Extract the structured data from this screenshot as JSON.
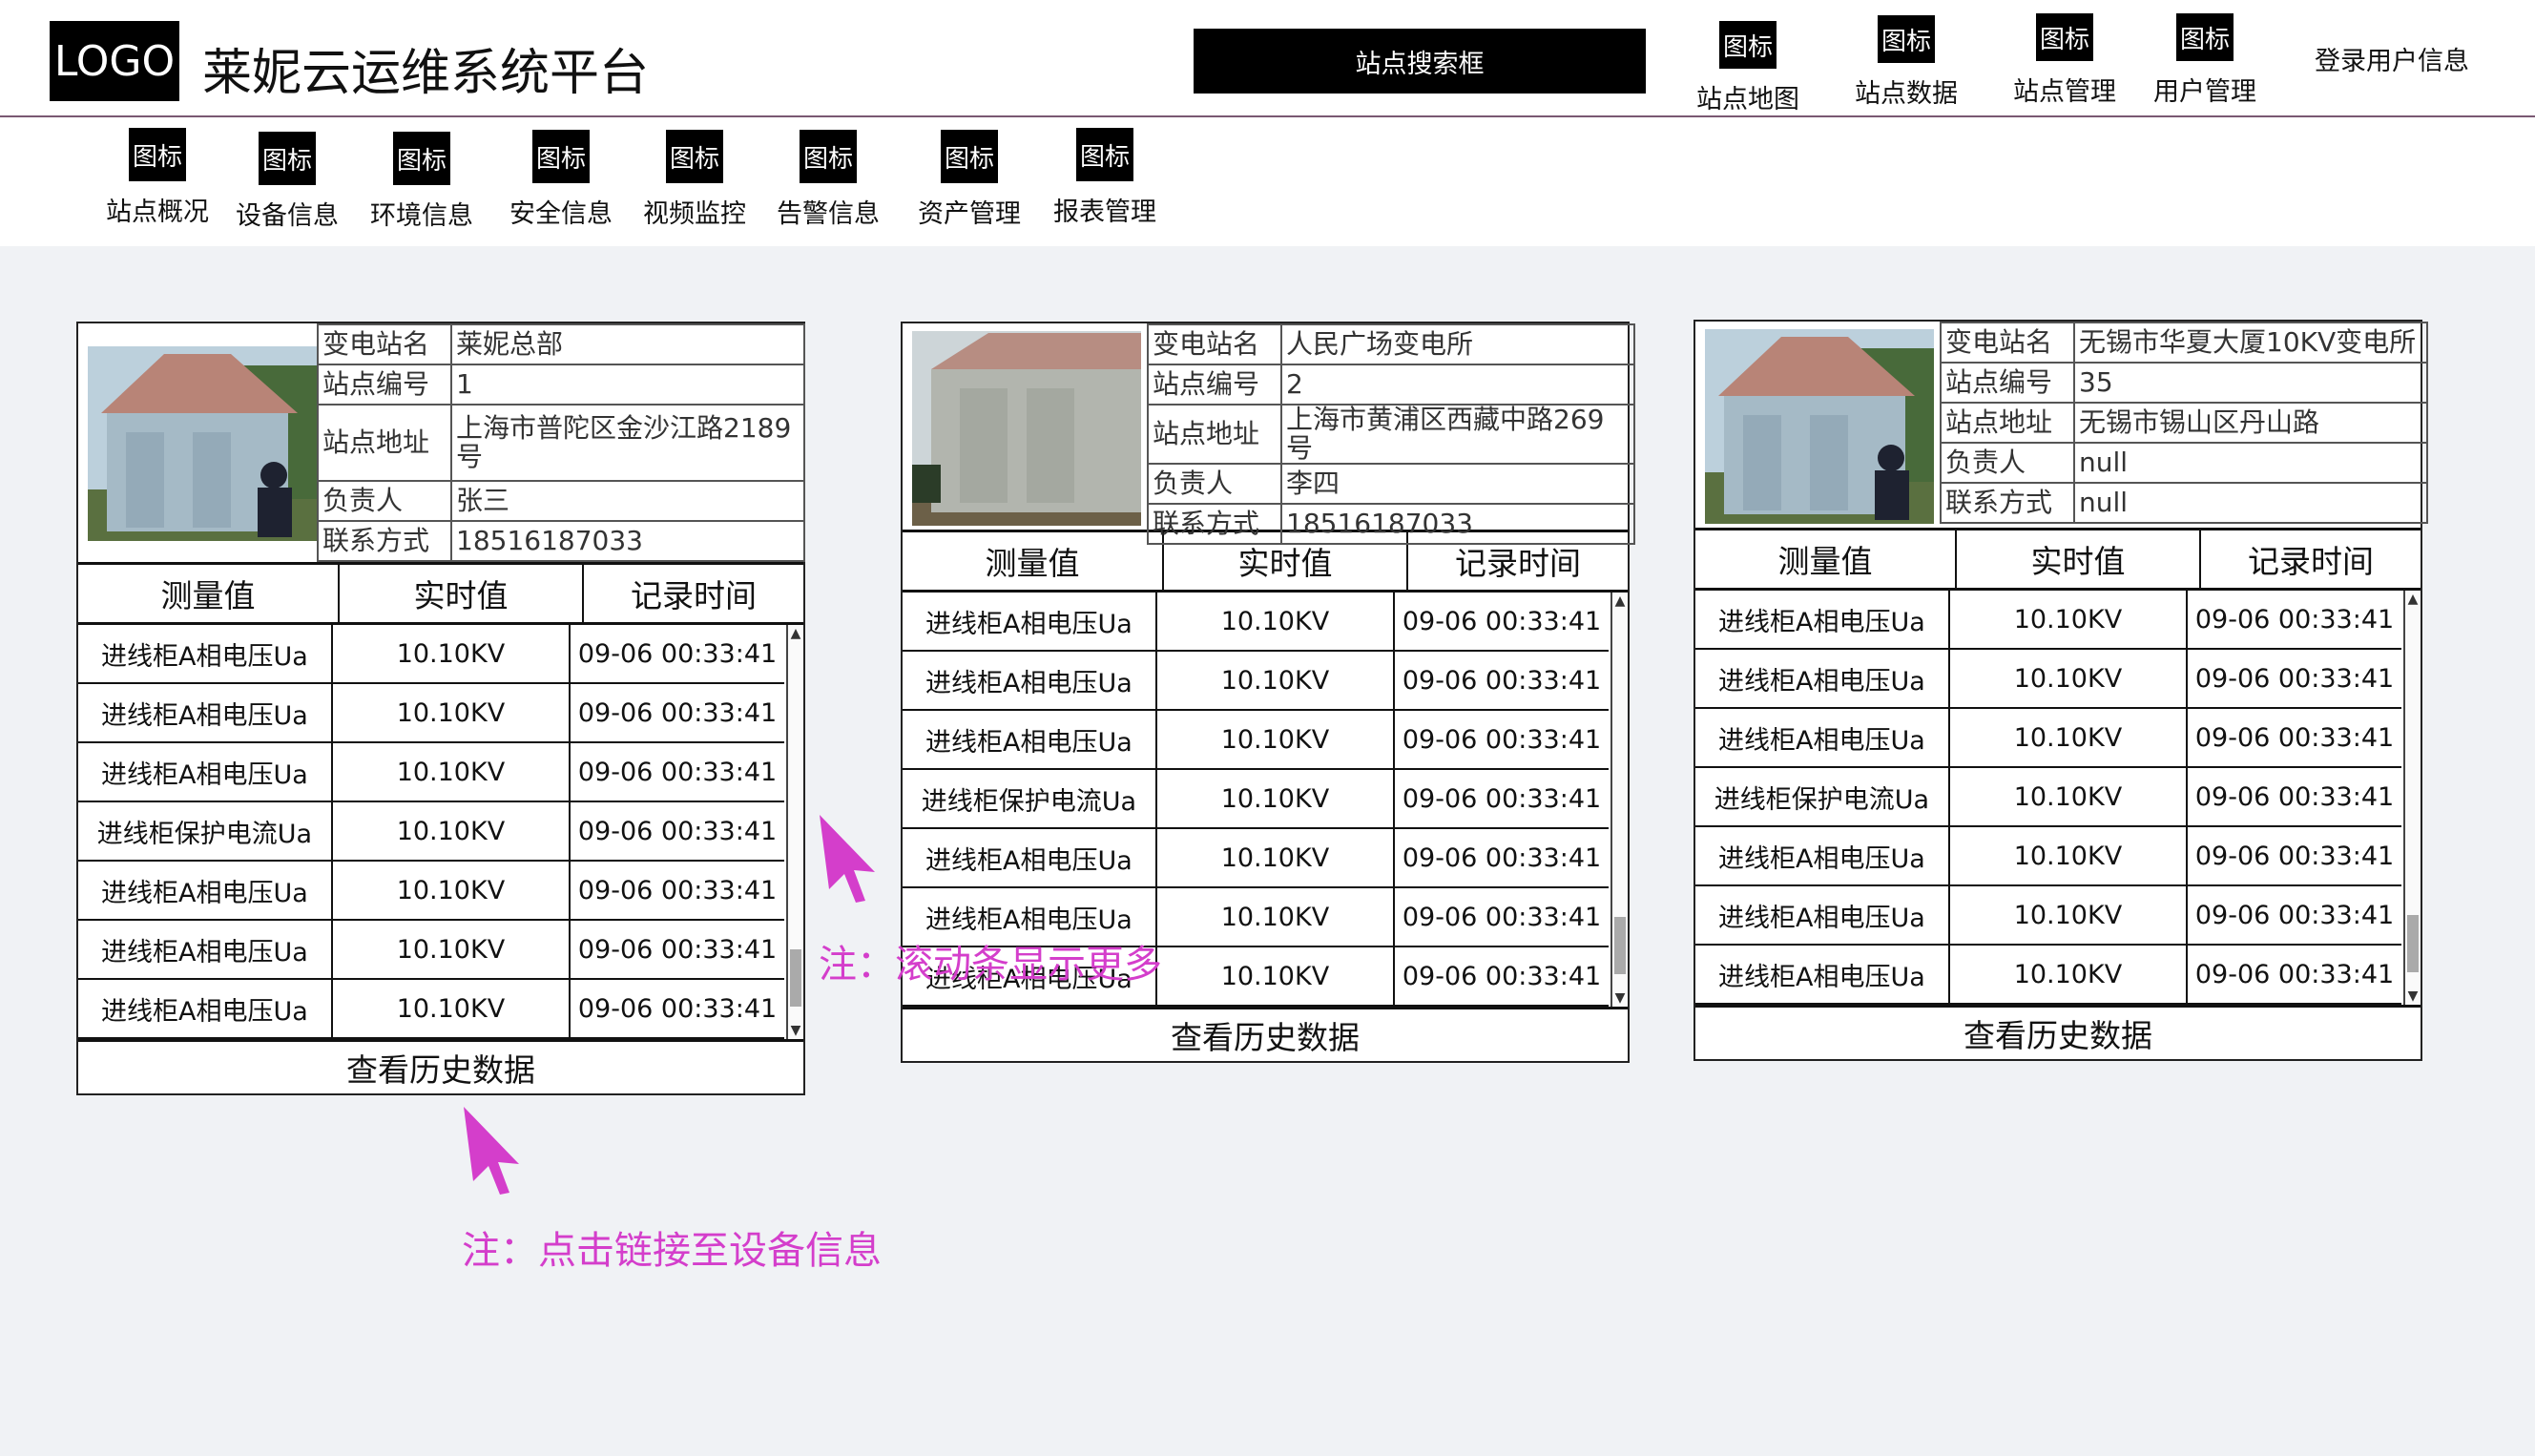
{
  "header": {
    "logo": "LOGO",
    "title": "莱妮云运维系统平台",
    "search_label": "站点搜索框",
    "user_info": "登录用户信息",
    "nav": [
      {
        "icon": "图标",
        "label": "站点地图"
      },
      {
        "icon": "图标",
        "label": "站点数据"
      },
      {
        "icon": "图标",
        "label": "站点管理"
      },
      {
        "icon": "图标",
        "label": "用户管理"
      }
    ]
  },
  "subnav": [
    {
      "icon": "图标",
      "label": "站点概况"
    },
    {
      "icon": "图标",
      "label": "设备信息"
    },
    {
      "icon": "图标",
      "label": "环境信息"
    },
    {
      "icon": "图标",
      "label": "安全信息"
    },
    {
      "icon": "图标",
      "label": "视频监控"
    },
    {
      "icon": "图标",
      "label": "告警信息"
    },
    {
      "icon": "图标",
      "label": "资产管理"
    },
    {
      "icon": "图标",
      "label": "报表管理"
    }
  ],
  "cards": [
    {
      "info": [
        {
          "key": "变电站名",
          "value": "莱妮总部"
        },
        {
          "key": "站点编号",
          "value": "1"
        },
        {
          "key": "站点地址",
          "value": "上海市普陀区金沙江路2189号"
        },
        {
          "key": "负责人",
          "value": "张三"
        },
        {
          "key": "联系方式",
          "value": "18516187033"
        }
      ],
      "columns": [
        "测量值",
        "实时值",
        "记录时间"
      ],
      "rows": [
        [
          "进线柜A相电压Ua",
          "10.10KV",
          "09-06 00:33:41"
        ],
        [
          "进线柜A相电压Ua",
          "10.10KV",
          "09-06 00:33:41"
        ],
        [
          "进线柜A相电压Ua",
          "10.10KV",
          "09-06 00:33:41"
        ],
        [
          "进线柜保护电流Ua",
          "10.10KV",
          "09-06 00:33:41"
        ],
        [
          "进线柜A相电压Ua",
          "10.10KV",
          "09-06 00:33:41"
        ],
        [
          "进线柜A相电压Ua",
          "10.10KV",
          "09-06 00:33:41"
        ],
        [
          "进线柜A相电压Ua",
          "10.10KV",
          "09-06 00:33:41"
        ]
      ],
      "history": "查看历史数据"
    },
    {
      "info": [
        {
          "key": "变电站名",
          "value": "人民广场变电所"
        },
        {
          "key": "站点编号",
          "value": "2"
        },
        {
          "key": "站点地址",
          "value": "上海市黄浦区西藏中路269号"
        },
        {
          "key": "负责人",
          "value": "李四"
        },
        {
          "key": "联系方式",
          "value": "18516187033"
        }
      ],
      "columns": [
        "测量值",
        "实时值",
        "记录时间"
      ],
      "rows": [
        [
          "进线柜A相电压Ua",
          "10.10KV",
          "09-06 00:33:41"
        ],
        [
          "进线柜A相电压Ua",
          "10.10KV",
          "09-06 00:33:41"
        ],
        [
          "进线柜A相电压Ua",
          "10.10KV",
          "09-06 00:33:41"
        ],
        [
          "进线柜保护电流Ua",
          "10.10KV",
          "09-06 00:33:41"
        ],
        [
          "进线柜A相电压Ua",
          "10.10KV",
          "09-06 00:33:41"
        ],
        [
          "进线柜A相电压Ua",
          "10.10KV",
          "09-06 00:33:41"
        ],
        [
          "进线柜A相电压Ua",
          "10.10KV",
          "09-06 00:33:41"
        ]
      ],
      "history": "查看历史数据"
    },
    {
      "info": [
        {
          "key": "变电站名",
          "value": "无锡市华夏大厦10KV变电所"
        },
        {
          "key": "站点编号",
          "value": "35"
        },
        {
          "key": "站点地址",
          "value": "无锡市锡山区丹山路"
        },
        {
          "key": "负责人",
          "value": "null"
        },
        {
          "key": "联系方式",
          "value": "null"
        }
      ],
      "columns": [
        "测量值",
        "实时值",
        "记录时间"
      ],
      "rows": [
        [
          "进线柜A相电压Ua",
          "10.10KV",
          "09-06 00:33:41"
        ],
        [
          "进线柜A相电压Ua",
          "10.10KV",
          "09-06 00:33:41"
        ],
        [
          "进线柜A相电压Ua",
          "10.10KV",
          "09-06 00:33:41"
        ],
        [
          "进线柜保护电流Ua",
          "10.10KV",
          "09-06 00:33:41"
        ],
        [
          "进线柜A相电压Ua",
          "10.10KV",
          "09-06 00:33:41"
        ],
        [
          "进线柜A相电压Ua",
          "10.10KV",
          "09-06 00:33:41"
        ],
        [
          "进线柜A相电压Ua",
          "10.10KV",
          "09-06 00:33:41"
        ]
      ],
      "history": "查看历史数据"
    }
  ],
  "notes": {
    "scroll": "注：滚动条显示更多",
    "link": "注：点击链接至设备信息"
  },
  "colors": {
    "annotation": "#d43ecb",
    "header_divider": "#7a5872",
    "page_background": "#f0f2f5"
  }
}
